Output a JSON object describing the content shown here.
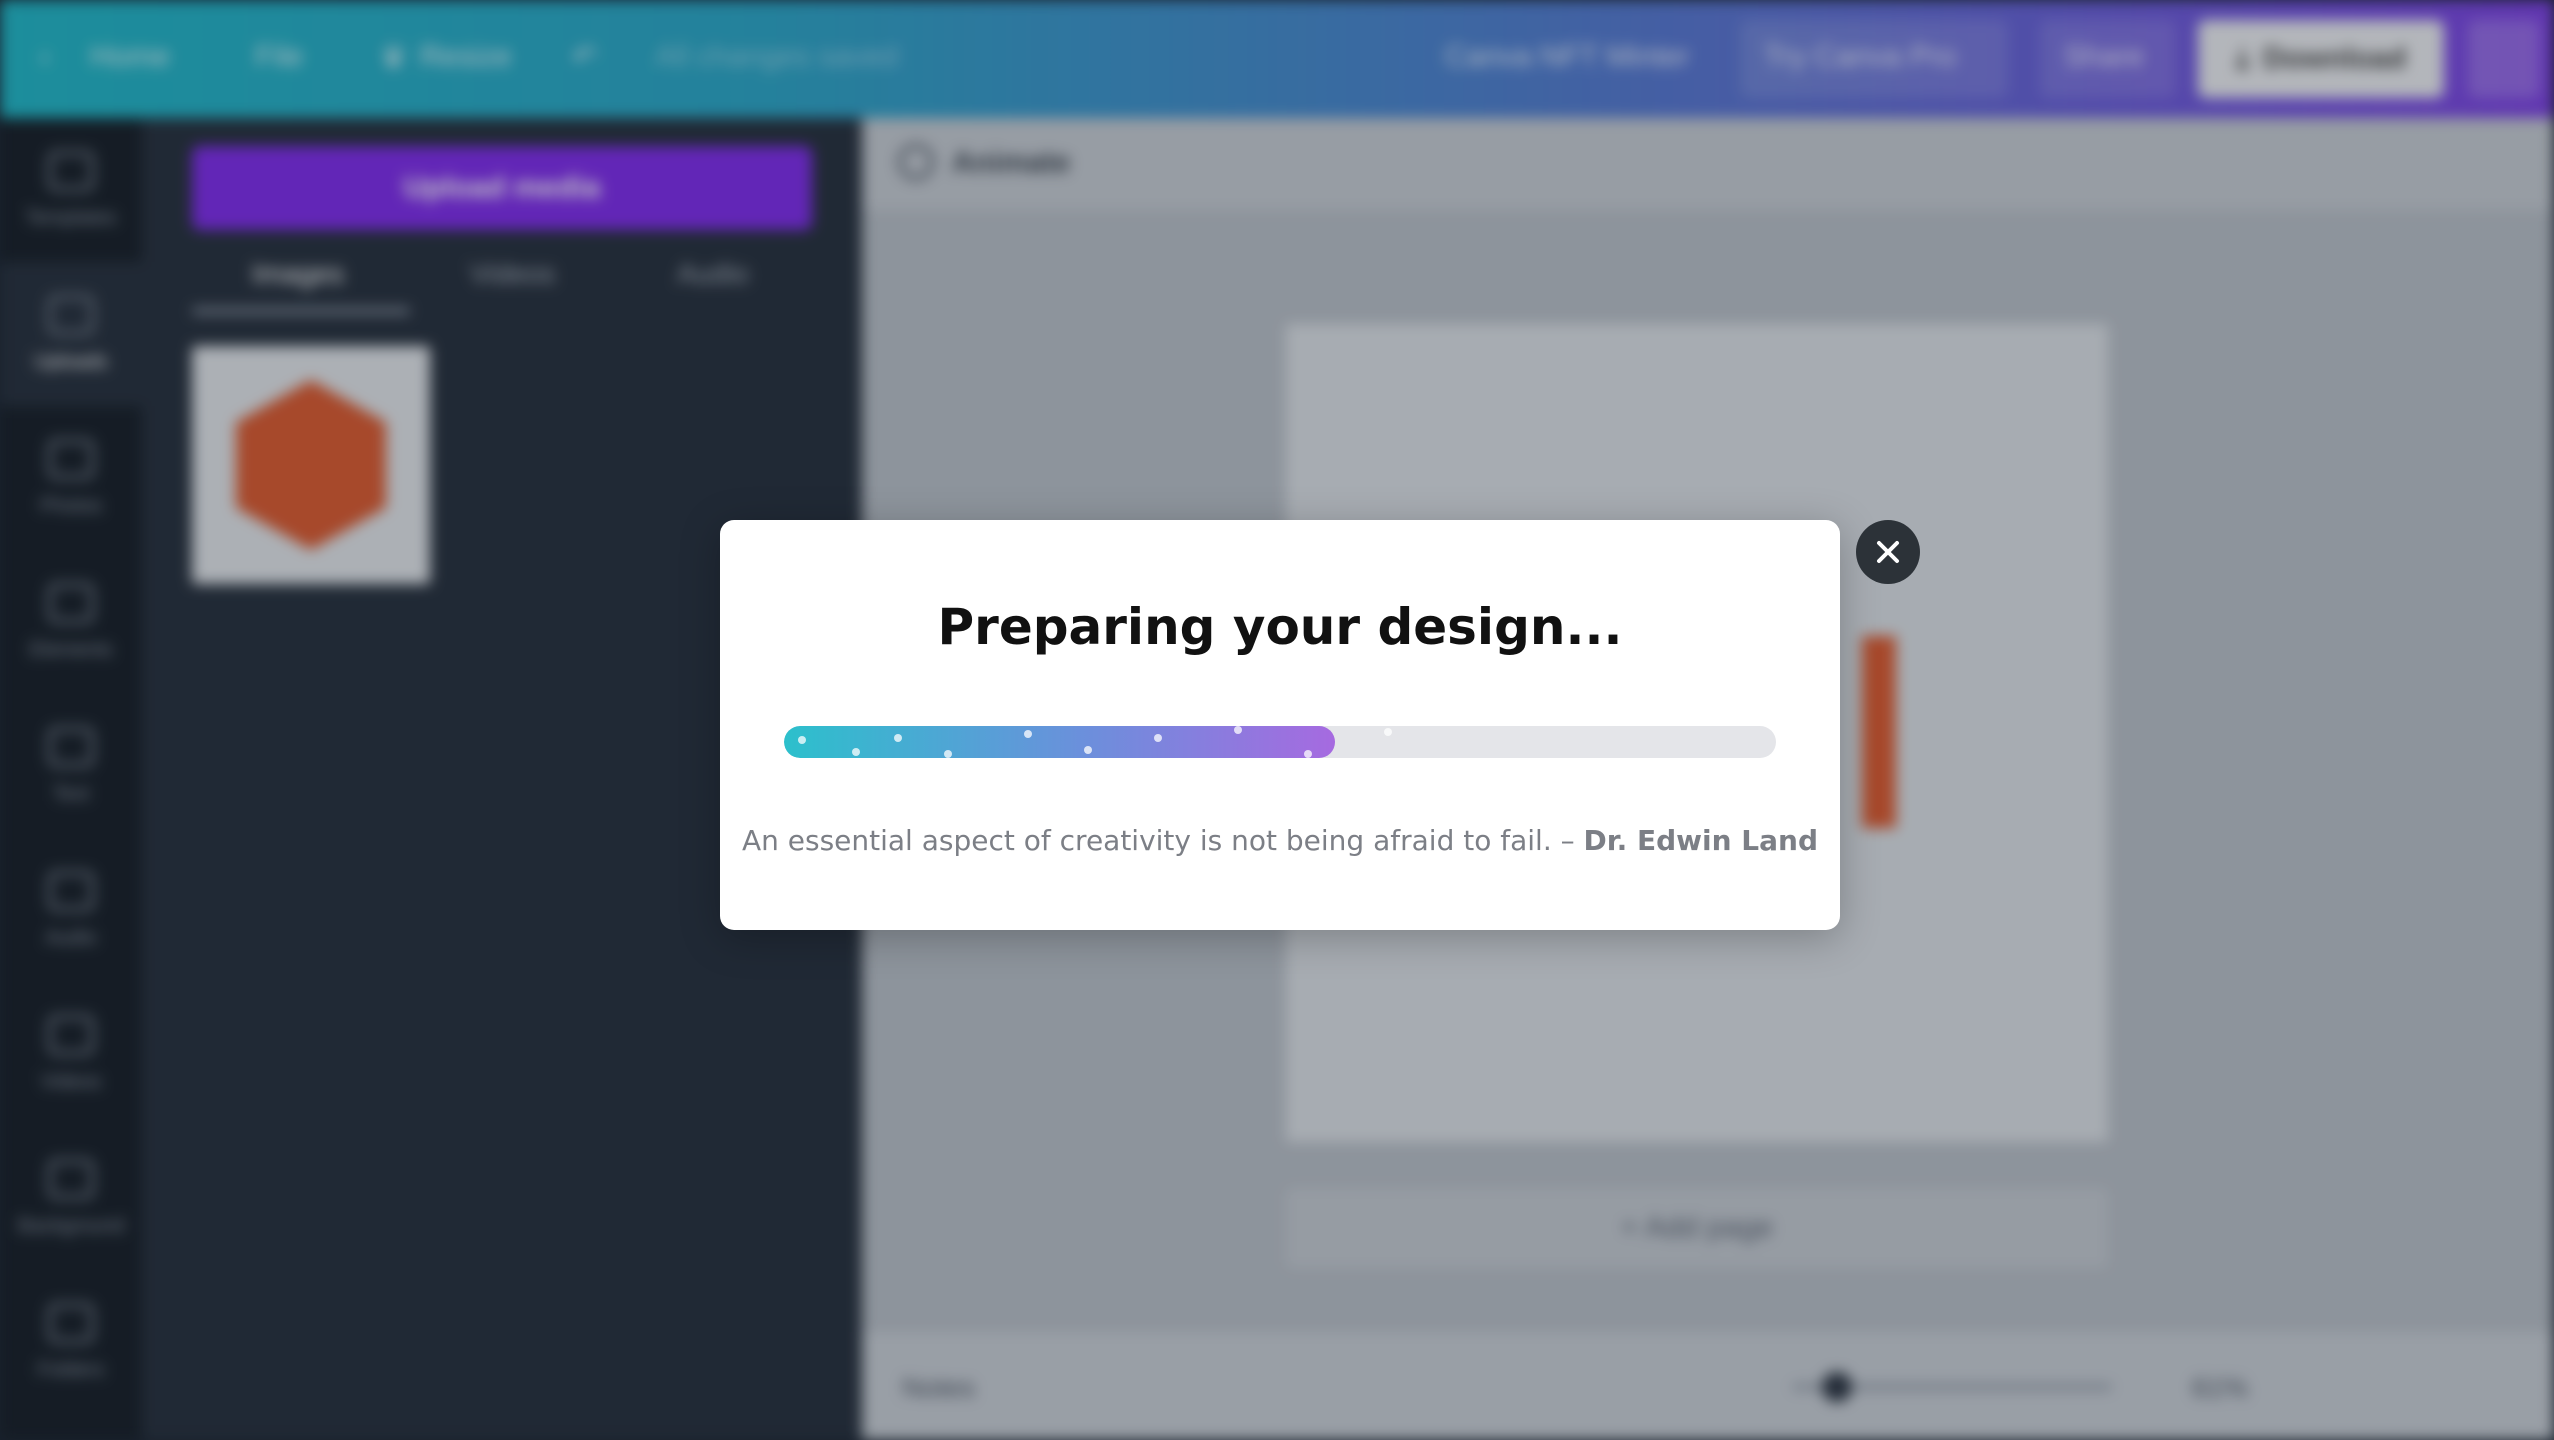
{
  "topbar": {
    "home_label": "Home",
    "file_label": "File",
    "resize_label": "Resize",
    "saved_label": "All changes saved",
    "doc_title": "Canva NFT Minter",
    "try_pro_label": "Try Canva Pro",
    "share_label": "Share",
    "download_label": "Download",
    "more_label": "···"
  },
  "sidebar": {
    "items": [
      {
        "label": "Templates",
        "icon": "template-icon"
      },
      {
        "label": "Uploads",
        "icon": "cloud-upload-icon"
      },
      {
        "label": "Photos",
        "icon": "image-icon"
      },
      {
        "label": "Elements",
        "icon": "shapes-icon"
      },
      {
        "label": "Text",
        "icon": "text-icon"
      },
      {
        "label": "Audio",
        "icon": "music-icon"
      },
      {
        "label": "Videos",
        "icon": "video-icon"
      },
      {
        "label": "Background",
        "icon": "background-icon"
      },
      {
        "label": "Folders",
        "icon": "folder-icon"
      }
    ]
  },
  "panel": {
    "upload_button": "Upload media",
    "tabs": [
      "Images",
      "Videos",
      "Audio"
    ]
  },
  "workarea": {
    "animate_label": "Animate",
    "add_page_label": "+ Add page",
    "notes_label": "Notes",
    "zoom_label": "61%"
  },
  "modal": {
    "title": "Preparing your design...",
    "progress_fraction": 0.555,
    "quote_text": "An essential aspect of creativity is not being afraid to fail. –",
    "quote_author": "Dr. Edwin Land",
    "close_symbol": "✕"
  },
  "colors": {
    "progress_start": "#2cc0cc",
    "progress_end": "#a66ae0",
    "track": "#e4e5e9",
    "brand_purple": "#7d2ae8"
  }
}
